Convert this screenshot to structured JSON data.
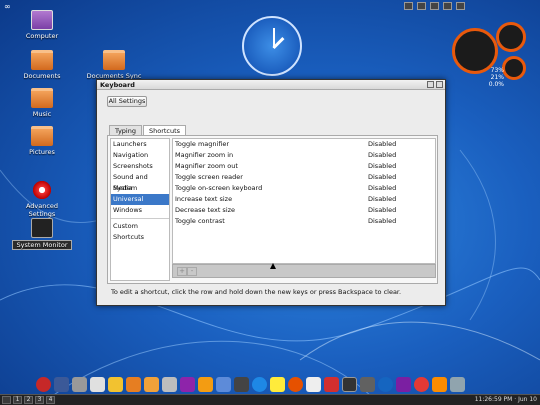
{
  "desktop": {
    "icons": [
      {
        "label": "Computer"
      },
      {
        "label": "Documents"
      },
      {
        "label": "Documents Sync"
      },
      {
        "label": "Music"
      },
      {
        "label": "Pictures"
      },
      {
        "label": "Advanced Settings"
      },
      {
        "label": "System Monitor"
      }
    ],
    "infinity": "∞"
  },
  "cpu_widget": {
    "line1": "73%",
    "line2": "21%",
    "line3": "0.0%"
  },
  "window": {
    "title": "Keyboard",
    "all_settings": "All Settings",
    "tabs": [
      {
        "label": "Typing"
      },
      {
        "label": "Shortcuts"
      }
    ],
    "categories": [
      "Launchers",
      "Navigation",
      "Screenshots",
      "Sound and Media",
      "System",
      "Universal Access",
      "Windows",
      "Custom Shortcuts"
    ],
    "selected_category": "Universal Access",
    "shortcuts": [
      {
        "name": "Toggle magnifier",
        "value": "Disabled"
      },
      {
        "name": "Magnifier zoom in",
        "value": "Disabled"
      },
      {
        "name": "Magnifier zoom out",
        "value": "Disabled"
      },
      {
        "name": "Toggle screen reader",
        "value": "Disabled"
      },
      {
        "name": "Toggle on-screen keyboard",
        "value": "Disabled"
      },
      {
        "name": "Increase text size",
        "value": "Disabled"
      },
      {
        "name": "Decrease text size",
        "value": "Disabled"
      },
      {
        "name": "Toggle contrast",
        "value": "Disabled"
      }
    ],
    "add_symbol": "+",
    "remove_symbol": "-",
    "hint": "To edit a shortcut, click the row and hold down the new keys or press Backspace to clear."
  },
  "panel": {
    "workspaces": [
      "1",
      "2",
      "3",
      "4"
    ],
    "clock": "11:26:59 PM · Jun 10"
  },
  "colors": {
    "accent": "#3b78c8",
    "desktop": "#1a5fbf"
  }
}
